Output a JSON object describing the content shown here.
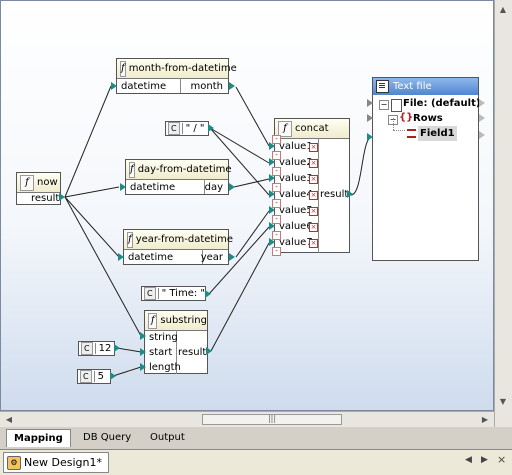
{
  "nodes": {
    "now": {
      "title": "now",
      "output": "result"
    },
    "month_from_datetime": {
      "title": "month-from-datetime",
      "input": "datetime",
      "output": "month"
    },
    "day_from_datetime": {
      "title": "day-from-datetime",
      "input": "datetime",
      "output": "day"
    },
    "year_from_datetime": {
      "title": "year-from-datetime",
      "input": "datetime",
      "output": "year"
    },
    "concat": {
      "title": "concat",
      "inputs": [
        "value1",
        "value2",
        "value3",
        "value4",
        "value5",
        "value6",
        "value7"
      ],
      "output": "result"
    },
    "substring": {
      "title": "substring",
      "inputs": [
        "string",
        "start",
        "length"
      ],
      "output": "result"
    }
  },
  "constants": {
    "icon_label": "C",
    "slash": "\" / \"",
    "time": "\" Time: \"",
    "start": "12",
    "length": "5"
  },
  "text_file": {
    "title": "Text file",
    "file": "File: (default)",
    "rows": "Rows",
    "field": "Field1"
  },
  "tabs": [
    "Mapping",
    "DB Query",
    "Output"
  ],
  "active_tab": "Mapping",
  "document_tab": "New Design1*",
  "colors": {
    "connector": "#1e8c86",
    "header_gradient": "#f0eccd",
    "textfile_header": "#4f86cf"
  }
}
